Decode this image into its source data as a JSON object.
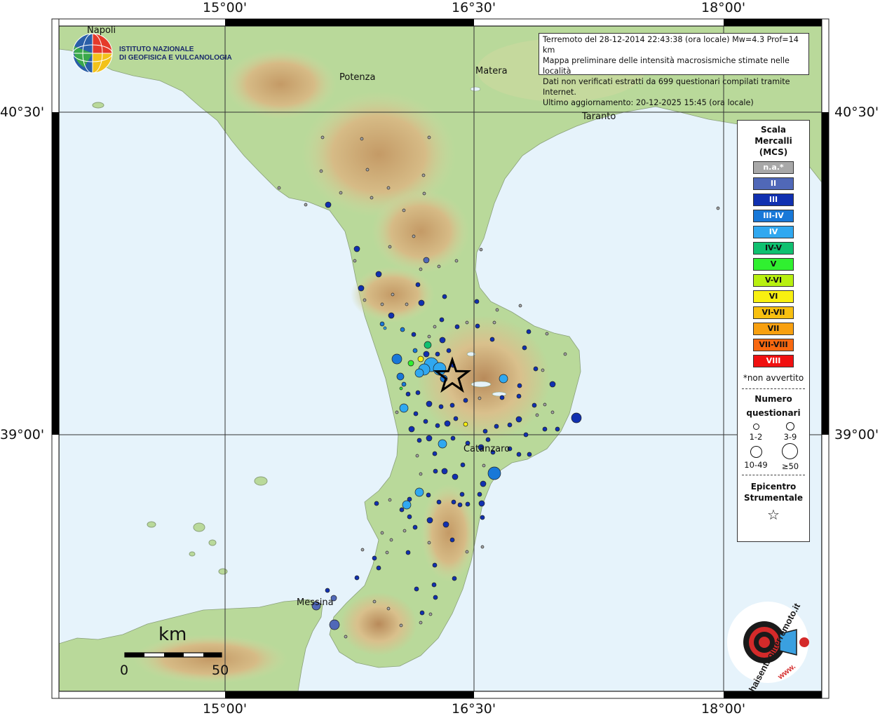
{
  "map": {
    "lon_labels": [
      "15°00'",
      "16°30'",
      "18°00'"
    ],
    "lat_labels": [
      "40°30'",
      "39°00'"
    ]
  },
  "info": {
    "line1": "Terremoto del 28-12-2014 22:43:38 (ora locale) Mw=4.3 Prof=14 km",
    "line2": "Mappa preliminare delle intensità macrosismiche stimate nelle località",
    "line3": "Dati non verificati estratti da 699 questionari compilati tramite Internet.",
    "line4": "Ultimo aggiornamento: 20-12-2025 15:45 (ora locale)"
  },
  "institute": {
    "line1": "ISTITUTO NAZIONALE",
    "line2": "DI GEOFISICA E VULCANOLOGIA"
  },
  "cities": {
    "napoli": "Napoli",
    "potenza": "Potenza",
    "matera": "Matera",
    "taranto": "Taranto",
    "catanzaro": "Catanzaro",
    "messina": "Messina"
  },
  "legend": {
    "title": "Scala",
    "title2": "Mercalli",
    "title3": "(MCS)",
    "classes": [
      {
        "label": "n.a.*",
        "color": "#a8a8a8",
        "text": "#ffffff"
      },
      {
        "label": "II",
        "color": "#5068b8",
        "text": "#ffffff"
      },
      {
        "label": "III",
        "color": "#1030b0",
        "text": "#ffffff"
      },
      {
        "label": "III-IV",
        "color": "#1878d8",
        "text": "#ffffff"
      },
      {
        "label": "IV",
        "color": "#30a8f0",
        "text": "#ffffff"
      },
      {
        "label": "IV-V",
        "color": "#10c070",
        "text": "#111111"
      },
      {
        "label": "V",
        "color": "#30f030",
        "text": "#111111"
      },
      {
        "label": "V-VI",
        "color": "#b8f010",
        "text": "#111111"
      },
      {
        "label": "VI",
        "color": "#f8f010",
        "text": "#111111"
      },
      {
        "label": "VI-VII",
        "color": "#f8c010",
        "text": "#111111"
      },
      {
        "label": "VII",
        "color": "#f8a010",
        "text": "#111111"
      },
      {
        "label": "VII-VIII",
        "color": "#f86810",
        "text": "#111111"
      },
      {
        "label": "VIII",
        "color": "#f01010",
        "text": "#ffffff"
      }
    ],
    "not_felt": "*non avvertito",
    "count_title": "Numero",
    "count_title2": "questionari",
    "sizes": [
      "1-2",
      "3-9",
      "10-49",
      "≥50"
    ],
    "epic_title": "Epicentro",
    "epic_title2": "Strumentale",
    "star": "☆"
  },
  "scale_bar": {
    "unit": "km",
    "min": "0",
    "max": "50"
  },
  "logo_brand": {
    "text": "haisentitoilterremoto.it",
    "www": "www."
  }
}
